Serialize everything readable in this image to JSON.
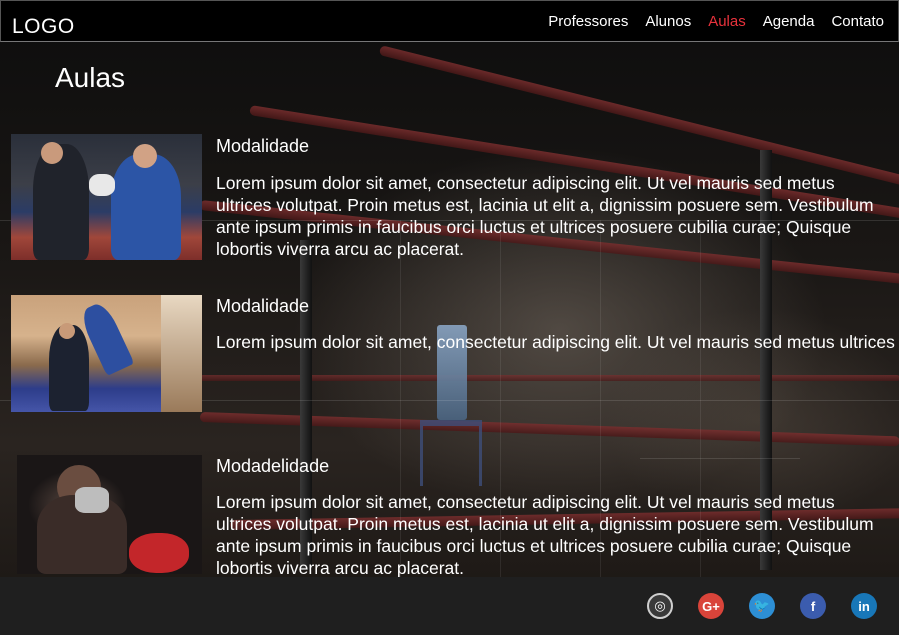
{
  "header": {
    "logo": "LOGO",
    "nav": [
      {
        "label": "Professores"
      },
      {
        "label": "Alunos"
      },
      {
        "label": "Aulas",
        "active": true
      },
      {
        "label": "Agenda"
      },
      {
        "label": "Contato"
      }
    ]
  },
  "main": {
    "title": "Aulas",
    "items": [
      {
        "title": "Modalidade",
        "text": "Lorem ipsum dolor sit amet, consectetur adipiscing elit. Ut vel mauris sed metus ultrices volutpat. Proin metus est, lacinia ut elit a, dignissim posuere sem. Vestibulum ante ipsum primis in faucibus orci luctus et ultrices posuere cubilia curae; Quisque lobortis viverra arcu ac placerat."
      },
      {
        "title": "Modalidade",
        "text": "Lorem ipsum dolor sit amet, consectetur adipiscing elit. Ut vel mauris sed metus ultrices"
      },
      {
        "title": "Modadelidade",
        "text": "Lorem ipsum dolor sit amet, consectetur adipiscing elit. Ut vel mauris sed metus ultrices volutpat. Proin metus est, lacinia ut elit a, dignissim posuere sem. Vestibulum ante ipsum primis in faucibus orci luctus et ultrices posuere cubilia curae; Quisque lobortis viverra arcu ac placerat."
      }
    ]
  },
  "footer": {
    "social": [
      {
        "icon": "instagram-icon",
        "glyph": "◎"
      },
      {
        "icon": "google-plus-icon",
        "glyph": "G+"
      },
      {
        "icon": "twitter-icon",
        "glyph": "🐦"
      },
      {
        "icon": "facebook-icon",
        "glyph": "f"
      },
      {
        "icon": "linkedin-icon",
        "glyph": "in"
      }
    ]
  },
  "colors": {
    "active_nav": "#e8323c",
    "header_bg": "#000000",
    "footer_bg": "#1f1f1f"
  }
}
